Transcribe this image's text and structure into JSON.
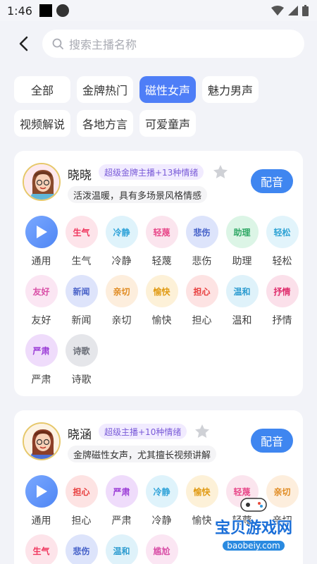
{
  "status": {
    "time": "1:46"
  },
  "search": {
    "placeholder": "搜索主播名称"
  },
  "tags": [
    {
      "label": "全部",
      "active": false
    },
    {
      "label": "金牌热门",
      "active": false
    },
    {
      "label": "磁性女声",
      "active": true
    },
    {
      "label": "魅力男声",
      "active": false
    },
    {
      "label": "视频解说",
      "active": false
    },
    {
      "label": "各地方言",
      "active": false
    },
    {
      "label": "可爱童声",
      "active": false
    }
  ],
  "dub_label": "配音",
  "colors": {
    "accent": "#4e7ef7",
    "dub_button": "#3f86f0",
    "badge_text": "#7a5bd8"
  },
  "anchors": [
    {
      "name": "晓晓",
      "badge": "超级金牌主播+13种情绪",
      "desc": "活泼温暖，具有多场景风格情感",
      "emotions": [
        {
          "icon": "play-icon",
          "label": "通用",
          "bg": "#cfe0ff",
          "fg": "#4f86f4"
        },
        {
          "chip": "生气",
          "label": "生气",
          "bg": "#fde4ea",
          "fg": "#f0375f"
        },
        {
          "chip": "冷静",
          "label": "冷静",
          "bg": "#dff3fb",
          "fg": "#2ea2d8"
        },
        {
          "chip": "轻蔑",
          "label": "轻蔑",
          "bg": "#fbe5ee",
          "fg": "#e8498a"
        },
        {
          "chip": "悲伤",
          "label": "悲伤",
          "bg": "#dde4fb",
          "fg": "#4460c8"
        },
        {
          "chip": "助理",
          "label": "助理",
          "bg": "#dcf5e6",
          "fg": "#2fa865"
        },
        {
          "chip": "轻松",
          "label": "轻松",
          "bg": "#e2f4fb",
          "fg": "#2fa3d4"
        },
        {
          "chip": "友好",
          "label": "友好",
          "bg": "#fbe6f3",
          "fg": "#d94fa7"
        },
        {
          "chip": "新闻",
          "label": "新闻",
          "bg": "#dee4fb",
          "fg": "#4b64c9"
        },
        {
          "chip": "亲切",
          "label": "亲切",
          "bg": "#fdeedd",
          "fg": "#e08a20"
        },
        {
          "chip": "愉快",
          "label": "愉快",
          "bg": "#fdf1d8",
          "fg": "#e09a12"
        },
        {
          "chip": "担心",
          "label": "担心",
          "bg": "#fde3e3",
          "fg": "#e83c3c"
        },
        {
          "chip": "温和",
          "label": "温和",
          "bg": "#dff2fa",
          "fg": "#2d9cd0"
        },
        {
          "chip": "抒情",
          "label": "抒情",
          "bg": "#fbe0ea",
          "fg": "#e02f6e"
        },
        {
          "chip": "严肃",
          "label": "严肃",
          "bg": "#efdcfb",
          "fg": "#9a3ad6"
        },
        {
          "chip": "诗歌",
          "label": "诗歌",
          "bg": "#e5e6ea",
          "fg": "#6b6f78"
        }
      ]
    },
    {
      "name": "晓涵",
      "badge": "超级主播+10种情绪",
      "desc": "金牌磁性女声，尤其擅长视频讲解",
      "emotions": [
        {
          "icon": "play-icon",
          "label": "通用",
          "bg": "#cfe0ff",
          "fg": "#4f86f4"
        },
        {
          "chip": "担心",
          "label": "担心",
          "bg": "#fde3e3",
          "fg": "#e83c3c"
        },
        {
          "chip": "严肃",
          "label": "严肃",
          "bg": "#efdcfb",
          "fg": "#9a3ad6"
        },
        {
          "chip": "冷静",
          "label": "冷静",
          "bg": "#dff3fb",
          "fg": "#2ea2d8"
        },
        {
          "chip": "愉快",
          "label": "愉快",
          "bg": "#fdf1d8",
          "fg": "#e09a12"
        },
        {
          "chip": "轻蔑",
          "label": "轻蔑",
          "bg": "#fbe5ee",
          "fg": "#e8498a"
        },
        {
          "chip": "亲切",
          "label": "亲切",
          "bg": "#fdeedd",
          "fg": "#e08a20"
        },
        {
          "chip": "生气",
          "label": "",
          "bg": "#fde4ea",
          "fg": "#f0375f"
        },
        {
          "chip": "悲伤",
          "label": "",
          "bg": "#dde4fb",
          "fg": "#4460c8"
        },
        {
          "chip": "温和",
          "label": "",
          "bg": "#dff2fa",
          "fg": "#2d9cd0"
        },
        {
          "chip": "尴尬",
          "label": "",
          "bg": "#fbe6f3",
          "fg": "#d94fa7"
        }
      ]
    }
  ],
  "watermark": {
    "text": "宝贝游戏网",
    "url": "baobeiy.com"
  }
}
